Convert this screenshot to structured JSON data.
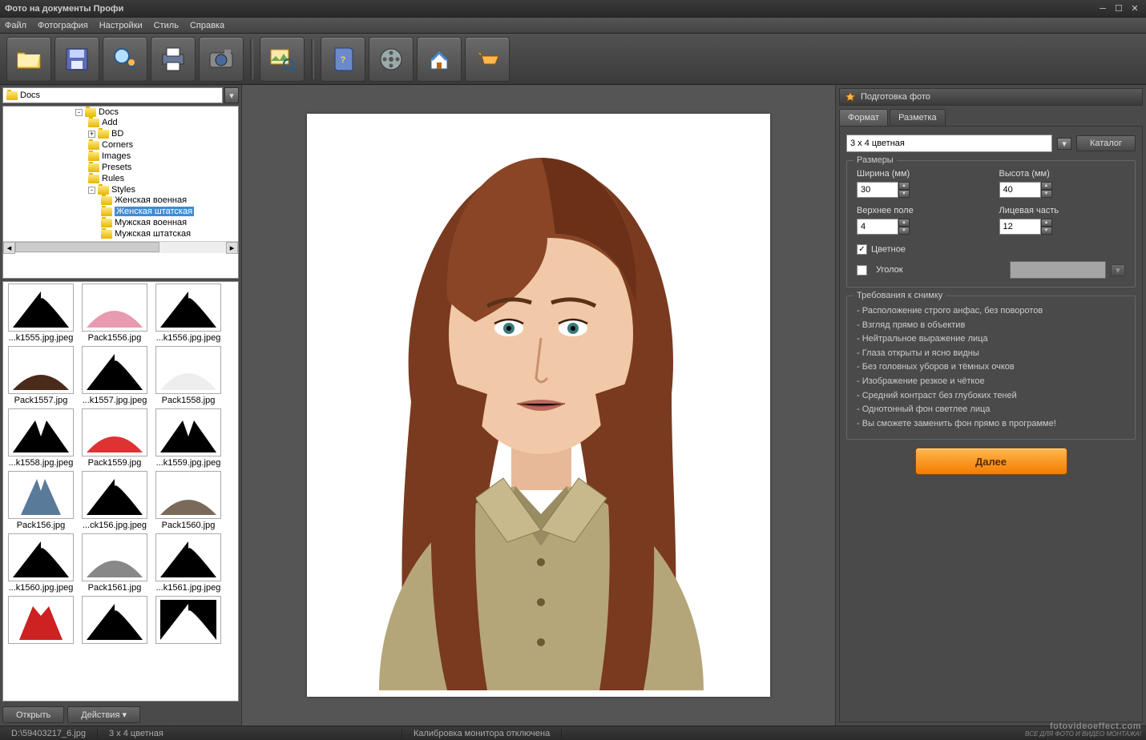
{
  "window": {
    "title": "Фото на документы Профи"
  },
  "menu": [
    "Файл",
    "Фотография",
    "Настройки",
    "Стиль",
    "Справка"
  ],
  "toolbar_icons": [
    "folder-open-icon",
    "save-icon",
    "preview-icon",
    "print-icon",
    "camera-icon",
    "picture-search-icon",
    "help-book-icon",
    "video-icon",
    "home-icon",
    "cart-icon"
  ],
  "path": {
    "value": "Docs"
  },
  "tree": {
    "root": "Docs",
    "children": [
      "Add",
      "BD",
      "Corners",
      "Images",
      "Presets",
      "Rules"
    ],
    "styles_node": "Styles",
    "styles": [
      "Женская военная",
      "Женская штатская",
      "Мужская военная",
      "Мужская штатская"
    ],
    "selected": "Женская штатская"
  },
  "thumbs": [
    "...k1555.jpg.jpeg",
    "Pack1556.jpg",
    "...k1556.jpg.jpeg",
    "Pack1557.jpg",
    "...k1557.jpg.jpeg",
    "Pack1558.jpg",
    "...k1558.jpg.jpeg",
    "Pack1559.jpg",
    "...k1559.jpg.jpeg",
    "Pack156.jpg",
    "...ck156.jpg.jpeg",
    "Pack1560.jpg",
    "...k1560.jpg.jpeg",
    "Pack1561.jpg",
    "...k1561.jpg.jpeg",
    "",
    "",
    ""
  ],
  "thumb_shapes": [
    "black-shoulders",
    "pink-jacket",
    "black-shoulders",
    "brown-sweater",
    "black-shoulders",
    "white-shirt",
    "black-v",
    "red-top",
    "black-v",
    "blue-halter",
    "black-shoulders",
    "print-top",
    "black-shoulders",
    "grey-jacket",
    "black-shoulders",
    "red-tank",
    "black-shoulders",
    "white-shoulders"
  ],
  "buttons": {
    "open": "Открыть",
    "actions": "Действия"
  },
  "side": {
    "title": "Подготовка фото",
    "tabs": [
      "Формат",
      "Разметка"
    ],
    "format_select": "3 x 4 цветная",
    "catalog": "Каталог",
    "sizes_legend": "Размеры",
    "labels": {
      "width": "Ширина (мм)",
      "height": "Высота (мм)",
      "top": "Верхнее поле",
      "face": "Лицевая часть"
    },
    "values": {
      "width": "30",
      "height": "40",
      "top": "4",
      "face": "12"
    },
    "color_chk": "Цветное",
    "corner_chk": "Уголок",
    "req_legend": "Требования к снимку",
    "requirements": [
      "Расположение строго анфас, без поворотов",
      "Взгляд прямо в объектив",
      "Нейтральное выражение лица",
      "Глаза открыты и ясно видны",
      "Без головных уборов и тёмных очков",
      "Изображение резкое и чёткое",
      "Средний контраст без глубоких теней",
      "Однотонный фон светлее лица",
      "Вы сможете заменить фон прямо в программе!"
    ],
    "next": "Далее"
  },
  "status": {
    "path": "D:\\59403217_6.jpg",
    "format": "3 x 4 цветная",
    "calib": "Калибровка монитора отключена"
  },
  "watermark": {
    "line1": "fotovideoeffect.com",
    "line2": "ВСЕ ДЛЯ ФОТО И ВИДЕО МОНТАЖА!"
  }
}
